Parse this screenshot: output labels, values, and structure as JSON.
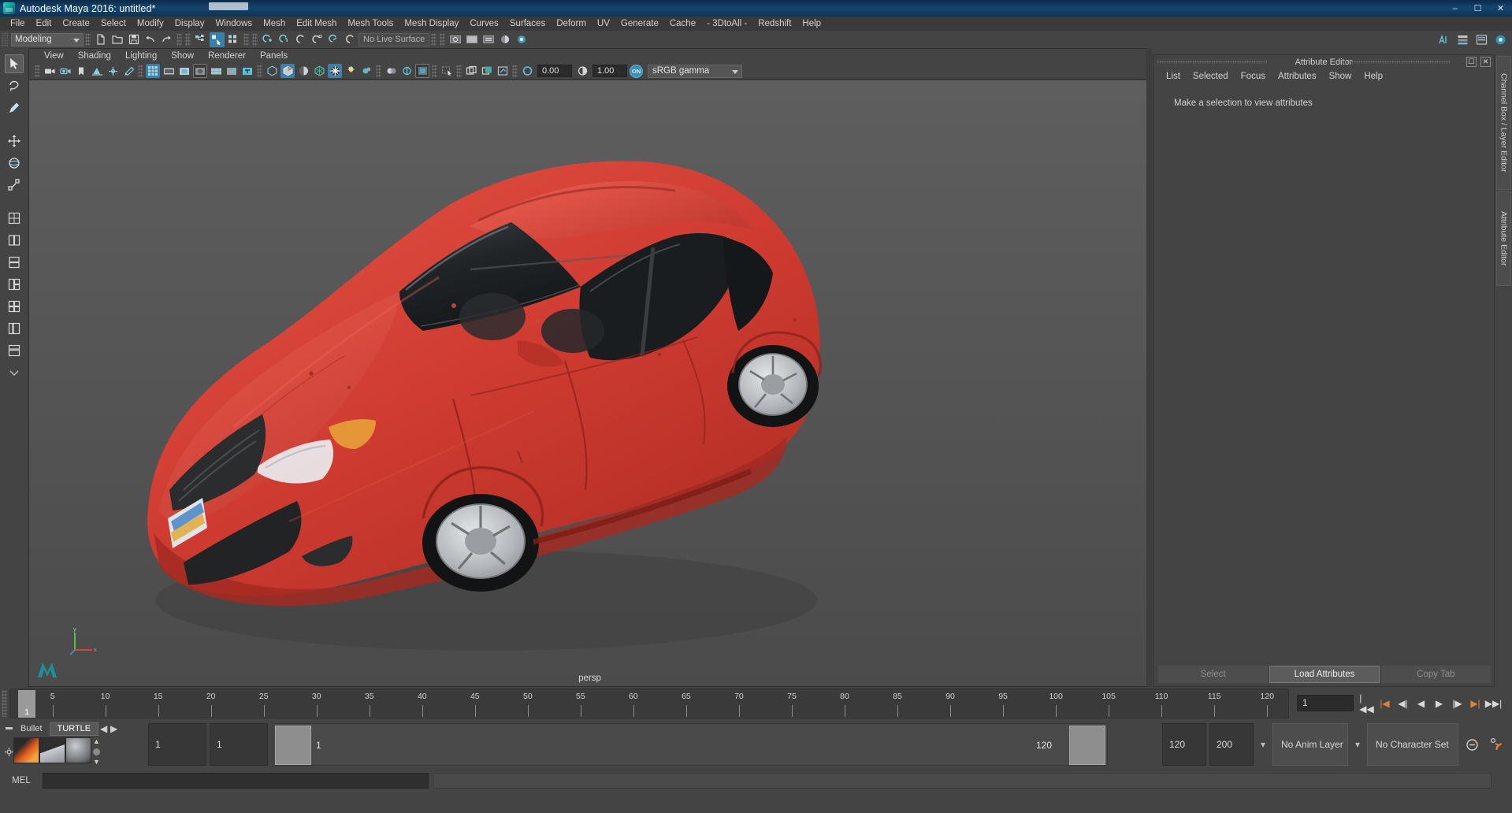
{
  "window": {
    "title": "Autodesk Maya 2016: untitled*",
    "logo_icon": "maya-logo-icon",
    "minimize_label": "–",
    "maximize_label": "☐",
    "close_label": "✕"
  },
  "menubar": {
    "items": [
      "File",
      "Edit",
      "Create",
      "Select",
      "Modify",
      "Display",
      "Windows",
      "Mesh",
      "Edit Mesh",
      "Mesh Tools",
      "Mesh Display",
      "Curves",
      "Surfaces",
      "Deform",
      "UV",
      "Generate",
      "Cache",
      "- 3DtoAll -",
      "Redshift",
      "Help"
    ]
  },
  "toolbar": {
    "menuset_value": "Modeling",
    "live_surface_value": "No Live Surface",
    "icons": [
      {
        "name": "new-scene-icon",
        "glyph": "὜B"
      },
      {
        "name": "open-scene-icon",
        "glyph": "folder"
      },
      {
        "name": "save-scene-icon",
        "glyph": "save"
      },
      {
        "name": "undo-icon",
        "glyph": "undo"
      },
      {
        "name": "redo-icon",
        "glyph": "redo"
      },
      {
        "name": "select-by-hierarchy-icon",
        "glyph": "hier"
      },
      {
        "name": "select-by-object-type-icon",
        "glyph": "obj",
        "active": true
      },
      {
        "name": "select-by-component-type-icon",
        "glyph": "comp"
      },
      {
        "name": "snap-to-grid-icon",
        "glyph": "grid"
      },
      {
        "name": "snap-to-curve-icon",
        "glyph": "curve"
      },
      {
        "name": "snap-to-point-icon",
        "glyph": "point"
      },
      {
        "name": "snap-to-projected-center-icon",
        "glyph": "pcenter"
      },
      {
        "name": "snap-to-view-plane-icon",
        "glyph": "vplane"
      },
      {
        "name": "make-live-icon",
        "glyph": "live"
      },
      {
        "name": "render-current-frame-icon",
        "glyph": "render"
      },
      {
        "name": "ipr-render-icon",
        "glyph": "ipr"
      },
      {
        "name": "render-settings-icon",
        "glyph": "rsettings"
      },
      {
        "name": "hypershade-icon",
        "glyph": "hypershade"
      },
      {
        "name": "render-view-icon",
        "glyph": "rview"
      }
    ],
    "right_icons": [
      {
        "name": "channel-box-toggle-icon"
      },
      {
        "name": "layer-editor-toggle-icon"
      },
      {
        "name": "attribute-editor-toggle-icon"
      },
      {
        "name": "workspace-icon"
      }
    ]
  },
  "toolbox": {
    "items": [
      {
        "name": "select-tool",
        "icon": "arrow-cursor-icon",
        "selected": true
      },
      {
        "name": "lasso-tool",
        "icon": "lasso-icon"
      },
      {
        "name": "paint-select-tool",
        "icon": "paint-brush-icon"
      },
      {
        "name": "move-tool",
        "icon": "move-arrows-icon"
      },
      {
        "name": "rotate-tool",
        "icon": "rotate-ring-icon"
      },
      {
        "name": "scale-tool",
        "icon": "scale-box-icon"
      },
      {
        "name": "layout-single-pane",
        "icon": "single-pane-icon"
      },
      {
        "name": "layout-two-pane-side",
        "icon": "two-pane-side-icon"
      },
      {
        "name": "layout-two-pane-stacked",
        "icon": "two-pane-stacked-icon"
      },
      {
        "name": "layout-three-pane",
        "icon": "three-pane-icon"
      },
      {
        "name": "layout-four-pane",
        "icon": "four-pane-icon"
      },
      {
        "name": "layout-persp-outliner",
        "icon": "persp-outliner-icon"
      },
      {
        "name": "layout-hypergraph",
        "icon": "hypergraph-icon"
      },
      {
        "name": "layout-more",
        "icon": "chevron-down-icon"
      }
    ]
  },
  "viewport": {
    "menu": [
      "View",
      "Shading",
      "Lighting",
      "Show",
      "Renderer",
      "Panels"
    ],
    "camera_label": "persp",
    "exposure_value": "0.00",
    "gamma_value": "1.00",
    "color_management_toggle": "ON",
    "color_profile": "sRGB gamma",
    "tool_icons": [
      {
        "name": "select-camera-icon"
      },
      {
        "name": "camera-attributes-icon"
      },
      {
        "name": "bookmark-icon"
      },
      {
        "name": "image-plane-icon"
      },
      {
        "name": "two-dimensional-pan-zoom-icon"
      },
      {
        "name": "grease-pencil-icon"
      },
      {
        "name": "grid-toggle-icon",
        "active": true
      },
      {
        "name": "film-gate-icon"
      },
      {
        "name": "resolution-gate-icon"
      },
      {
        "name": "gate-mask-icon",
        "framed": true
      },
      {
        "name": "field-chart-icon"
      },
      {
        "name": "safe-action-icon"
      },
      {
        "name": "safe-title-icon"
      },
      {
        "name": "wireframe-icon"
      },
      {
        "name": "smooth-shade-all-icon",
        "active": true
      },
      {
        "name": "shade-wireframe-icon"
      },
      {
        "name": "use-default-material-icon"
      },
      {
        "name": "textured-icon",
        "active": true
      },
      {
        "name": "use-all-lights-icon"
      },
      {
        "name": "shadows-icon"
      },
      {
        "name": "screen-space-ao-icon"
      },
      {
        "name": "motion-blur-icon"
      },
      {
        "name": "multisample-aa-icon"
      },
      {
        "name": "depth-of-field-icon",
        "framed": true
      },
      {
        "name": "isolate-select-icon"
      },
      {
        "name": "xray-icon"
      },
      {
        "name": "xray-joints-icon"
      },
      {
        "name": "xray-active-components-icon"
      },
      {
        "name": "exposure-icon"
      },
      {
        "name": "gamma-icon"
      }
    ]
  },
  "attribute_editor": {
    "title": "Attribute Editor",
    "menu": [
      "List",
      "Selected",
      "Focus",
      "Attributes",
      "Show",
      "Help"
    ],
    "empty_message": "Make a selection to view attributes",
    "buttons": [
      {
        "label": "Select",
        "active": false
      },
      {
        "label": "Load Attributes",
        "active": true
      },
      {
        "label": "Copy Tab",
        "active": false
      }
    ],
    "restore_icon": "restore-window-icon",
    "close_icon": "close-icon"
  },
  "right_tabs": [
    {
      "label": "Channel Box / Layer Editor",
      "name": "tab-channel-box-layer-editor"
    },
    {
      "label": "Attribute Editor",
      "name": "tab-attribute-editor"
    }
  ],
  "timeline": {
    "current_frame": "1",
    "frame_field_value": "1",
    "tick_labels": [
      5,
      10,
      15,
      20,
      25,
      30,
      35,
      40,
      45,
      50,
      55,
      60,
      65,
      70,
      75,
      80,
      85,
      90,
      95,
      100,
      105,
      110,
      115,
      120
    ],
    "end_label": "120",
    "playback_buttons": [
      {
        "name": "go-to-start-button",
        "glyph": "|◀◀"
      },
      {
        "name": "step-back-keyframe-button",
        "glyph": "|◀"
      },
      {
        "name": "step-back-frame-button",
        "glyph": "◀|"
      },
      {
        "name": "play-backwards-button",
        "glyph": "◀"
      },
      {
        "name": "play-forwards-button",
        "glyph": "▶"
      },
      {
        "name": "step-forward-frame-button",
        "glyph": "|▶"
      },
      {
        "name": "step-forward-keyframe-button",
        "glyph": "▶|"
      },
      {
        "name": "go-to-end-button",
        "glyph": "▶▶|"
      }
    ]
  },
  "range_slider": {
    "anim_start": "1",
    "range_start": "1",
    "slider_start_label": "1",
    "slider_end_label": "120",
    "range_end": "120",
    "anim_end": "200",
    "anim_layer": "No Anim Layer",
    "character_set": "No Character Set",
    "auto_keyframe_icon": "auto-keyframe-icon",
    "animation_prefs_icon": "animation-preferences-icon"
  },
  "shelf": {
    "tabs": [
      "Bullet",
      "TURTLE"
    ],
    "active_tab": "TURTLE",
    "prev_icon": "chevron-left-icon",
    "next_icon": "chevron-right-icon",
    "swatches": [
      "turtle-render-icon",
      "turtle-bake-icon",
      "turtle-sphere-icon"
    ],
    "scroll_up_icon": "scroll-up-icon",
    "scroll_down_icon": "scroll-down-icon",
    "menu_icon": "shelf-menu-icon",
    "settings_icon": "gear-icon"
  },
  "command_line": {
    "label": "MEL",
    "input_value": "",
    "output_value": ""
  },
  "scene": {
    "object": "red sedan car 3d model",
    "body_color": "#cf3b30",
    "body_shadow_color": "#8f241d",
    "glass_color": "#1b1b1b",
    "wheel_color": "#b9bcc0",
    "ground_color": "#555555"
  }
}
